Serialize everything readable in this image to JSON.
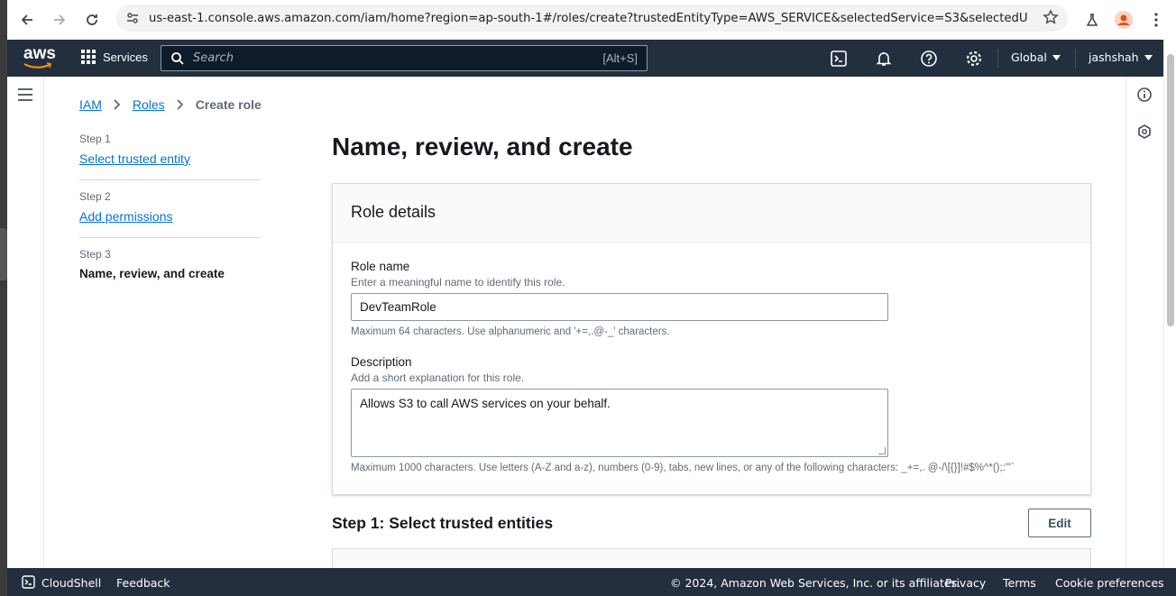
{
  "browser": {
    "url": "us-east-1.console.aws.amazon.com/iam/home?region=ap-south-1#/roles/create?trustedEntityType=AWS_SERVICE&selectedService=S3&selectedUseCas..."
  },
  "topnav": {
    "logo": "aws",
    "services_label": "Services",
    "search_placeholder": "Search",
    "search_shortcut": "[Alt+S]",
    "region": "Global",
    "user": "jashshah"
  },
  "breadcrumb": {
    "items": [
      "IAM",
      "Roles"
    ],
    "current": "Create role"
  },
  "steps": [
    {
      "label": "Step 1",
      "title": "Select trusted entity"
    },
    {
      "label": "Step 2",
      "title": "Add permissions"
    },
    {
      "label": "Step 3",
      "title": "Name, review, and create"
    }
  ],
  "page": {
    "title": "Name, review, and create"
  },
  "role_details": {
    "header": "Role details",
    "role_name": {
      "label": "Role name",
      "description": "Enter a meaningful name to identify this role.",
      "value": "DevTeamRole",
      "constraint": "Maximum 64 characters. Use alphanumeric and '+=,.@-_' characters."
    },
    "description": {
      "label": "Description",
      "description": "Add a short explanation for this role.",
      "value": "Allows S3 to call AWS services on your behalf.",
      "constraint": "Maximum 1000 characters. Use letters (A-Z and a-z), numbers (0-9), tabs, new lines, or any of the following characters: _+=,. @-/\\[{}]!#$%^*();:\"'`"
    }
  },
  "step1_section": {
    "title": "Step 1: Select trusted entities",
    "edit_label": "Edit"
  },
  "footer": {
    "cloudshell": "CloudShell",
    "feedback": "Feedback",
    "copyright": "© 2024, Amazon Web Services, Inc. or its affiliates.",
    "privacy": "Privacy",
    "terms": "Terms",
    "cookies": "Cookie preferences"
  },
  "colors": {
    "nav_bg": "#232f3e",
    "link": "#0972d3",
    "aws_orange": "#ff9900"
  }
}
